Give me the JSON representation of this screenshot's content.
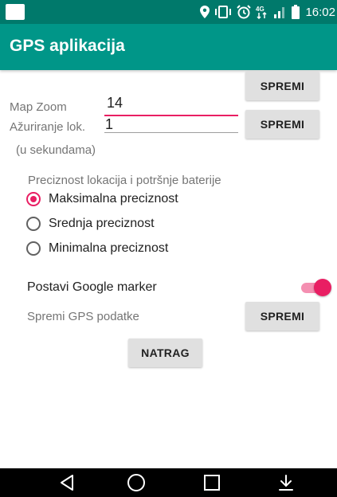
{
  "status_bar": {
    "time": "16:02",
    "icons": [
      "location-icon",
      "vibrate-icon",
      "alarm-icon",
      "data-4g-icon",
      "signal-icon",
      "battery-icon"
    ]
  },
  "app_bar": {
    "title": "GPS aplikacija",
    "color": "#009688"
  },
  "map_zoom": {
    "label": "Map Zoom",
    "value": "14",
    "button": "SPREMI"
  },
  "update_location": {
    "label": "Ažuriranje lok.",
    "value": "1",
    "button": "SPREMI",
    "hint": "(u sekundama)"
  },
  "precision": {
    "title": "Preciznost lokacija i potršnje baterije",
    "options": [
      {
        "label": "Maksimalna preciznost",
        "checked": true
      },
      {
        "label": "Srednja preciznost",
        "checked": false
      },
      {
        "label": "Minimalna preciznost",
        "checked": false
      }
    ]
  },
  "marker": {
    "label": "Postavi Google marker",
    "enabled": true
  },
  "save_gps": {
    "label": "Spremi GPS podatke",
    "button": "SPREMI"
  },
  "back_button": "NATRAG",
  "nav_bar": {
    "icons": [
      "back-triangle-icon",
      "home-circle-icon",
      "recents-square-icon",
      "download-arrow-icon"
    ]
  },
  "colors": {
    "accent": "#e91e63",
    "primary": "#009688",
    "primary_dark": "#00796b"
  }
}
